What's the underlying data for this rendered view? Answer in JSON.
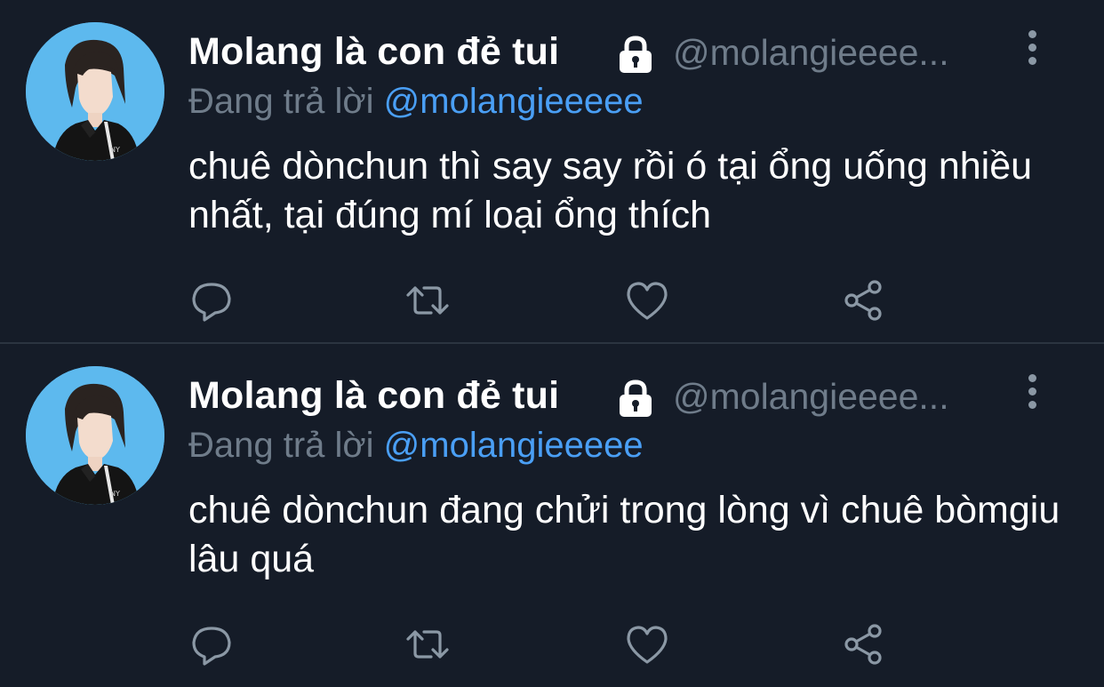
{
  "colors": {
    "background": "#151c28",
    "mention": "#4a9ff5",
    "muted": "#6f7c8a",
    "avatar_bg": "#5db9ee"
  },
  "tweets": [
    {
      "display_name": "Molang là con đẻ tui",
      "handle": "@molangieeee...",
      "reply_prefix": "Đang trả lời",
      "reply_to": "@molangieeeee",
      "text": "chuê dònchun thì say say rồi ó tại ổng uống nhiều nhất, tại đúng mí loại ổng thích",
      "icons": [
        "avatar",
        "lock-icon",
        "more-icon",
        "reply-icon",
        "retweet-icon",
        "like-icon",
        "share-icon"
      ]
    },
    {
      "display_name": "Molang là con đẻ tui",
      "handle": "@molangieeee...",
      "reply_prefix": "Đang trả lời",
      "reply_to": "@molangieeeee",
      "text": "chuê dònchun đang chửi trong lòng vì chuê bòmgiu lâu quá",
      "icons": [
        "avatar",
        "lock-icon",
        "more-icon",
        "reply-icon",
        "retweet-icon",
        "like-icon",
        "share-icon"
      ]
    }
  ]
}
